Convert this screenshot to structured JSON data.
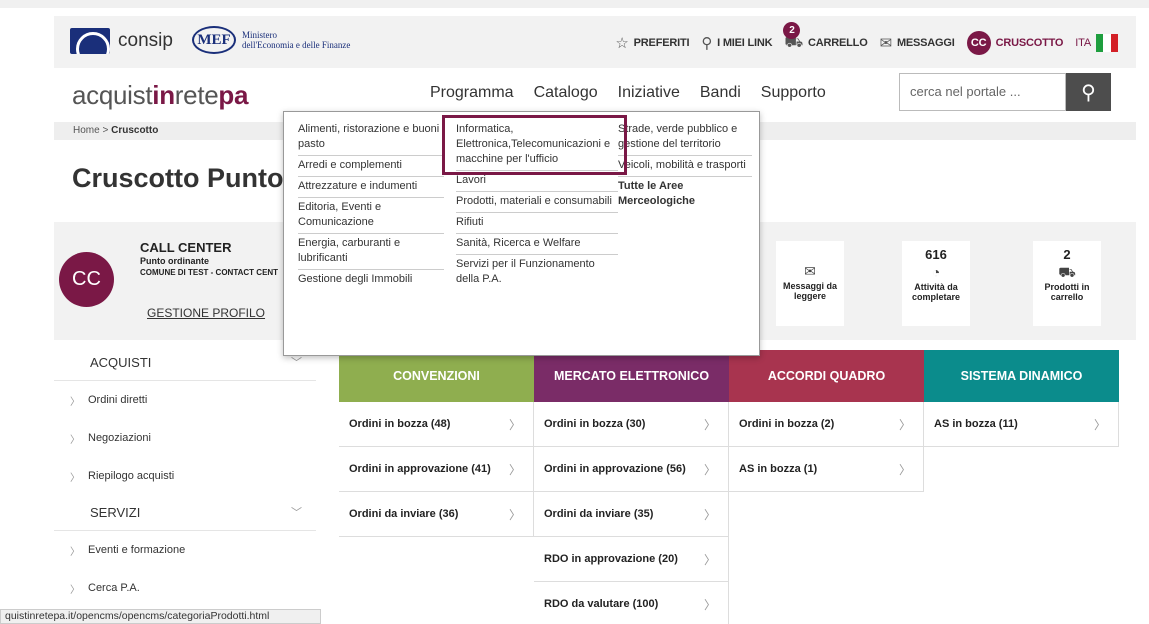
{
  "topbar": {
    "consip": "consip",
    "mef_abbr": "MEF",
    "mef_line1": "Ministero",
    "mef_line2": "dell'Economia e delle Finanze",
    "links": {
      "preferiti": "PREFERITI",
      "link": "I MIEI LINK",
      "carrello": "CARRELLO",
      "cart_count": "2",
      "messaggi": "MESSAGGI",
      "cc": "CC",
      "cruscotto": "CRUSCOTTO",
      "lang": "ITA"
    },
    "flag_colors": [
      "#1e9e3e",
      "#ffffff",
      "#d32027"
    ]
  },
  "header": {
    "brand_a": "acquist",
    "brand_b": "in",
    "brand_c": "rete",
    "brand_d": "pa",
    "nav": [
      "Programma",
      "Catalogo",
      "Iniziative",
      "Bandi",
      "Supporto"
    ],
    "search_placeholder": "cerca nel portale ..."
  },
  "breadcrumb": {
    "home": "Home",
    "current": "Cruscotto"
  },
  "page_title": "Cruscotto Punto",
  "profile": {
    "initials": "CC",
    "name": "CALL CENTER",
    "role": "Punto ordinante",
    "ente": "COMUNE DI TEST - CONTACT CENT",
    "link": "GESTIONE PROFILO",
    "stats": [
      {
        "num": "",
        "l1": "Messaggi da",
        "l2": "leggere"
      },
      {
        "num": "616",
        "l1": "Attività da",
        "l2": "completare"
      },
      {
        "num": "2",
        "l1": "Prodotti in",
        "l2": "carrello"
      }
    ]
  },
  "sidebar": {
    "acquisti": "ACQUISTI",
    "items1": [
      "Ordini diretti",
      "Negoziazioni",
      "Riepilogo acquisti"
    ],
    "servizi": "SERVIZI",
    "items2": [
      "Eventi e formazione",
      "Cerca P.A."
    ]
  },
  "columns": [
    {
      "title": "CONVENZIONI",
      "color": "#8fae4f",
      "rows": [
        "Ordini in bozza (48)",
        "Ordini in approvazione (41)",
        "Ordini da inviare (36)"
      ]
    },
    {
      "title": "MERCATO ELETTRONICO",
      "color": "#7a2c67",
      "rows": [
        "Ordini in bozza (30)",
        "Ordini in approvazione (56)",
        "Ordini da inviare (35)",
        "RDO in approvazione (20)",
        "RDO da valutare (100)"
      ]
    },
    {
      "title": "ACCORDI QUADRO",
      "color": "#a8344f",
      "rows": [
        "Ordini in bozza (2)",
        "AS in bozza (1)"
      ]
    },
    {
      "title": "SISTEMA DINAMICO",
      "color": "#0b8c8c",
      "rows": [
        "AS in bozza (11)"
      ]
    }
  ],
  "dropdown": {
    "col1": [
      "Alimenti, ristorazione e buoni pasto",
      "Arredi e complementi",
      "Attrezzature e indumenti",
      "Editoria, Eventi e Comunicazione",
      "Energia, carburanti e lubrificanti",
      "Gestione degli Immobili"
    ],
    "col2": [
      "Informatica, Elettronica,Telecomunicazioni e macchine per l'ufficio",
      "Lavori",
      "Prodotti, materiali e consumabili",
      "Rifiuti",
      "Sanità, Ricerca e Welfare",
      "Servizi per il Funzionamento della P.A."
    ],
    "col3": [
      "Strade, verde pubblico e gestione del territorio",
      "Veicoli, mobilità e trasporti",
      "Tutte le Aree Merceologiche"
    ]
  },
  "status_url": "quistinretepa.it/opencms/opencms/categoriaProdotti.html"
}
